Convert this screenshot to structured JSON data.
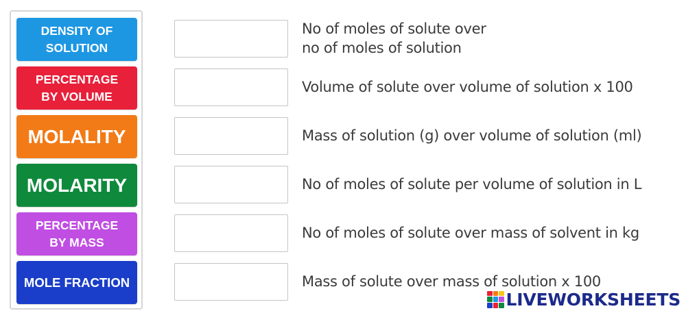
{
  "tiles": [
    {
      "label": "DENSITY OF\nSOLUTION",
      "color": "#1e97e3"
    },
    {
      "label": "PERCENTAGE\nBY VOLUME",
      "color": "#e8203a"
    },
    {
      "label": "MOLALITY",
      "color": "#f27b17"
    },
    {
      "label": "MOLARITY",
      "color": "#0f8a3c"
    },
    {
      "label": "PERCENTAGE\nBY MASS",
      "color": "#c04ee2"
    },
    {
      "label": "MOLE FRACTION",
      "color": "#1a3ec9"
    }
  ],
  "definitions": [
    "No of moles of solute over\nno of moles of solution",
    "Volume of solute over volume of solution x 100",
    "Mass of solution (g) over volume of solution (ml)",
    "No of moles of solute per volume of solution in L",
    "No of moles of solute over mass of solvent in kg",
    "Mass of solute over mass of solution x 100"
  ],
  "brand": {
    "name": "LIVEWORKSHEETS",
    "color": "#1c2a8a"
  }
}
